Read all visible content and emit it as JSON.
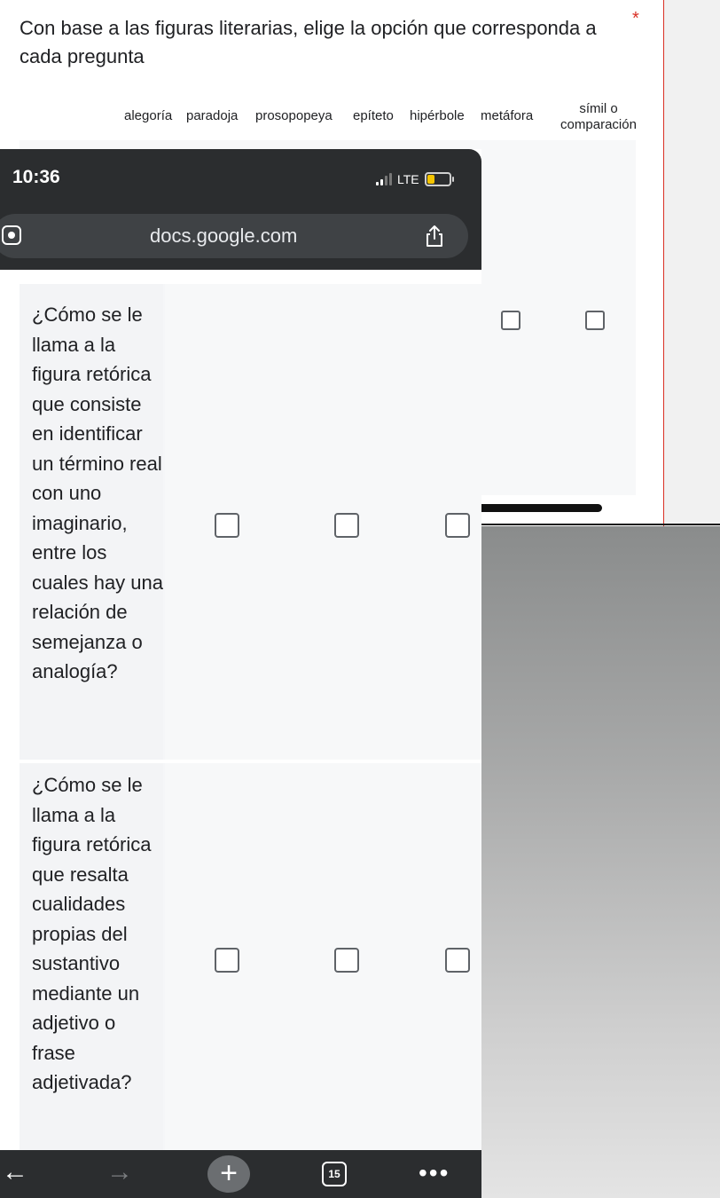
{
  "form": {
    "question_title": "Con base a las figuras literarias, elige la opción que corresponda a cada pregunta",
    "required_mark": "*",
    "columns": [
      "alegoría",
      "paradoja",
      "prosopopeya",
      "epíteto",
      "hipérbole",
      "metáfora"
    ],
    "last_column": {
      "line1": "símil o",
      "line2": "comparación"
    },
    "rows": [
      "¿Cómo se le llama a la figura retórica que consiste en identificar un término real con uno imaginario, entre los cuales hay una relación de semejanza o analogía?",
      "¿Cómo se le llama a la figura retórica que resalta cualidades propias del sustantivo mediante un adjetivo o frase adjetivada?"
    ]
  },
  "phone": {
    "status": {
      "time": "10:36",
      "network": "LTE"
    },
    "browser": {
      "url": "docs.google.com"
    },
    "bottom_bar": {
      "back": "←",
      "forward": "→",
      "new_tab": "+",
      "tab_count": "15",
      "more": "•••"
    }
  },
  "icons": [
    "lens-icon",
    "share-icon",
    "signal-icon",
    "battery-icon",
    "back-arrow-icon",
    "forward-arrow-icon",
    "plus-icon",
    "tabs-icon",
    "more-icon"
  ],
  "colors": {
    "required": "#d93025",
    "browser_chrome": "#2b2d2f",
    "url_bar": "#3f4245",
    "battery": "#f4c400"
  }
}
